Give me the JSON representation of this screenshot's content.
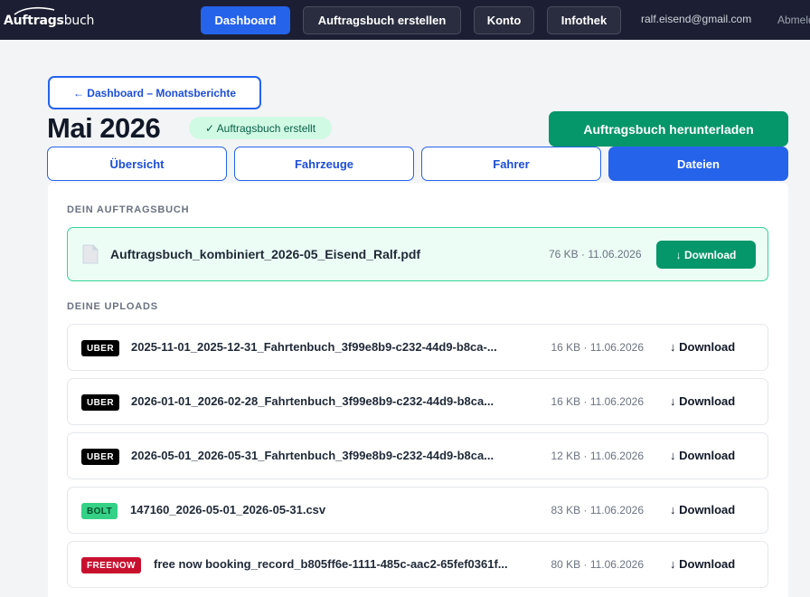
{
  "nav": {
    "logo_bold": "Auftrags",
    "logo_regular": "buch",
    "items": [
      {
        "label": "Dashboard",
        "active": true
      },
      {
        "label": "Auftragsbuch erstellen",
        "active": false
      },
      {
        "label": "Konto",
        "active": false
      },
      {
        "label": "Infothek",
        "active": false
      }
    ],
    "email": "ralf.eisend@gmail.com",
    "logout_label": "Abmelden"
  },
  "header": {
    "back_label": "← Dashboard – Monatsberichte",
    "title": "Mai 2026",
    "status": "✓ Auftragsbuch erstellt",
    "download_label": "Auftragsbuch herunterladen"
  },
  "tabs": [
    {
      "label": "Übersicht",
      "active": false
    },
    {
      "label": "Fahrzeuge",
      "active": false
    },
    {
      "label": "Fahrer",
      "active": false
    },
    {
      "label": "Dateien",
      "active": true
    }
  ],
  "combined": {
    "section_label": "DEIN AUFTRAGSBUCH",
    "file_name": "Auftragsbuch_kombiniert_2026-05_Eisend_Ralf.pdf",
    "meta": "76 KB · 11.06.2026",
    "download_label": "↓ Download",
    "icon": "document-icon"
  },
  "uploads": {
    "section_label": "DEINE UPLOADS",
    "items": [
      {
        "badge": "UBER",
        "provider": "uber",
        "file_name": "2025-11-01_2025-12-31_Fahrtenbuch_3f99e8b9-c232-44d9-b8ca-...",
        "meta": "16 KB · 11.06.2026",
        "download_label": "↓ Download"
      },
      {
        "badge": "UBER",
        "provider": "uber",
        "file_name": "2026-01-01_2026-02-28_Fahrtenbuch_3f99e8b9-c232-44d9-b8ca...",
        "meta": "16 KB · 11.06.2026",
        "download_label": "↓ Download"
      },
      {
        "badge": "UBER",
        "provider": "uber",
        "file_name": "2026-05-01_2026-05-31_Fahrtenbuch_3f99e8b9-c232-44d9-b8ca...",
        "meta": "12 KB · 11.06.2026",
        "download_label": "↓ Download"
      },
      {
        "badge": "BOLT",
        "provider": "bolt",
        "file_name": "147160_2026-05-01_2026-05-31.csv",
        "meta": "83 KB · 11.06.2026",
        "download_label": "↓ Download"
      },
      {
        "badge": "FREENOW",
        "provider": "freenow",
        "file_name": "free now booking_record_b805ff6e-1111-485c-aac2-65fef0361f...",
        "meta": "80 KB · 11.06.2026",
        "download_label": "↓ Download"
      }
    ]
  },
  "colors": {
    "nav_bg": "#1c1f33",
    "primary": "#2563eb",
    "success": "#059669",
    "uber": "#000000",
    "bolt": "#34d186",
    "freenow": "#c8102e"
  }
}
